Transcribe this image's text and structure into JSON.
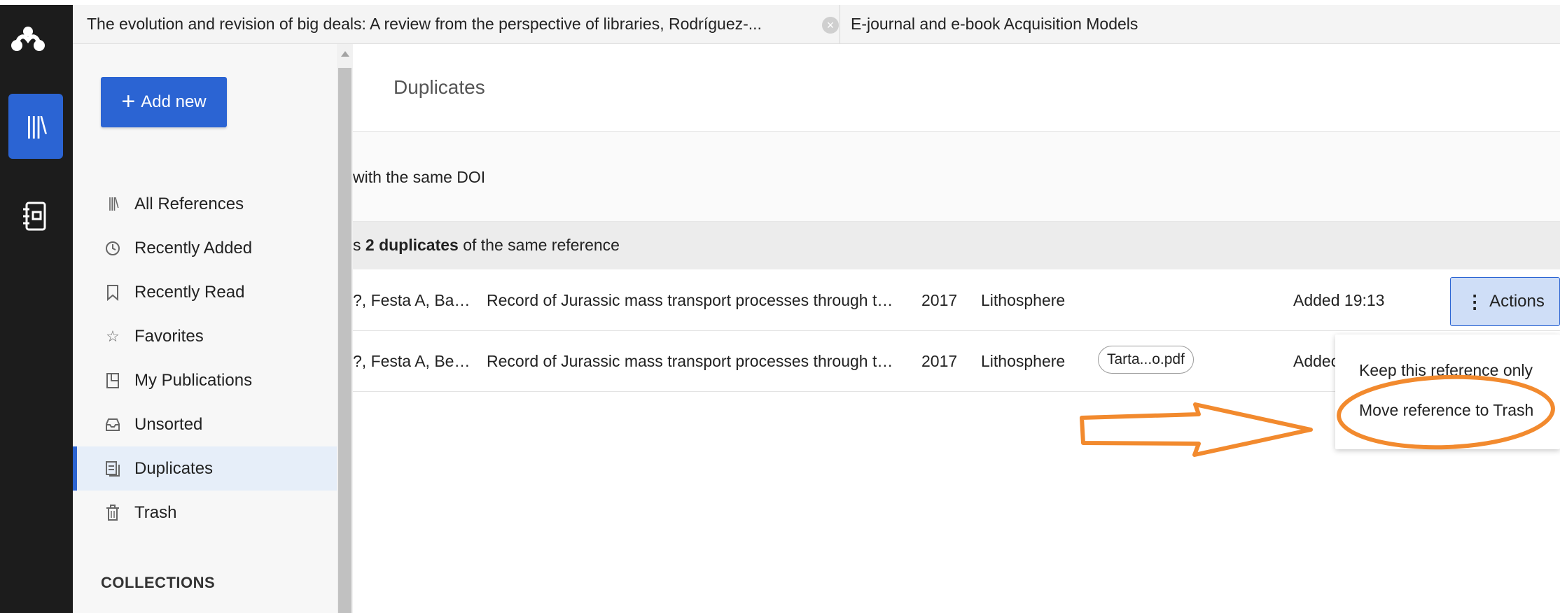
{
  "app": {
    "logo_icon": "mendeley-logo-icon",
    "rail": {
      "library_icon": "library-icon",
      "notebook_icon": "notebook-icon"
    }
  },
  "tabs": [
    {
      "label": "The evolution and revision of big deals: A review from the perspective of libraries, Rodríguez-...",
      "close_icon": "close-icon"
    },
    {
      "label": "E-journal and e-book Acquisition Models"
    }
  ],
  "sidebar": {
    "add_new_label": "Add new",
    "items": [
      {
        "label": "All References",
        "icon": "library-icon"
      },
      {
        "label": "Recently Added",
        "icon": "clock-icon"
      },
      {
        "label": "Recently Read",
        "icon": "bookmark-icon"
      },
      {
        "label": "Favorites",
        "icon": "star-icon"
      },
      {
        "label": "My Publications",
        "icon": "publication-icon"
      },
      {
        "label": "Unsorted",
        "icon": "inbox-icon"
      },
      {
        "label": "Duplicates",
        "icon": "duplicates-icon"
      },
      {
        "label": "Trash",
        "icon": "trash-icon"
      }
    ],
    "collections_heading": "COLLECTIONS"
  },
  "main": {
    "title": "Duplicates",
    "doi_text": "with the same DOI",
    "group": {
      "prefix": "s ",
      "bold": "2 duplicates",
      "suffix": " of the same reference"
    },
    "rows": [
      {
        "authors": "?, Festa A, Ba…",
        "title": "Record of Jurassic mass transport processes through t…",
        "year": "2017",
        "journal": "Lithosphere",
        "file": "",
        "added": "Added 19:13"
      },
      {
        "authors": "?, Festa A, Be…",
        "title": "Record of Jurassic mass transport processes through t…",
        "year": "2017",
        "journal": "Lithosphere",
        "file": "Tarta...o.pdf",
        "added": "Addec"
      }
    ],
    "actions_label": "Actions",
    "dropdown": [
      {
        "label": "Keep this reference only"
      },
      {
        "label": "Move reference to Trash"
      }
    ]
  },
  "colors": {
    "accent": "#2b64d3",
    "rail": "#1c1c1c",
    "annotation": "#f28a2e"
  }
}
